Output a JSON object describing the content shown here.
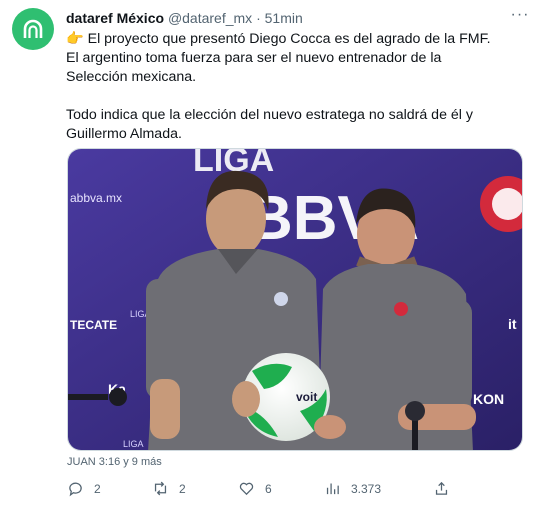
{
  "tweet": {
    "author_name": "dataref México",
    "handle": "@dataref_mx",
    "separator": "·",
    "time": "51min",
    "more_label": "···",
    "paragraph_1": "👉 El proyecto que presentó Diego Cocca es del agrado de la FMF. El argentino toma fuerza para ser el nuevo entrenador de la Selección mexicana.",
    "paragraph_2": "Todo indica que la elección del nuevo estratega no saldrá de él y Guillermo Almada.",
    "media_caption": "JUAN 3:16 y 9 más"
  },
  "media": {
    "backdrop_text": {
      "liga": "LIGA",
      "bbva": "BBVA",
      "sponsor_left": "abbva.mx",
      "sponsor_2": "TECATE",
      "sponsor_3": "Ka",
      "sponsor_right": "KON",
      "sponsor_right_2": "it",
      "ball_brand": "voit",
      "liga_small_1": "LIGA",
      "liga_small_2": "LIGA"
    }
  },
  "actions": {
    "replies": "2",
    "retweets": "2",
    "likes": "6",
    "views": "3.373"
  },
  "colors": {
    "avatar": "#2fbf71",
    "backdrop": "#3b2f86",
    "shirt": "#6e6e74",
    "ball": "#1fae4f"
  }
}
